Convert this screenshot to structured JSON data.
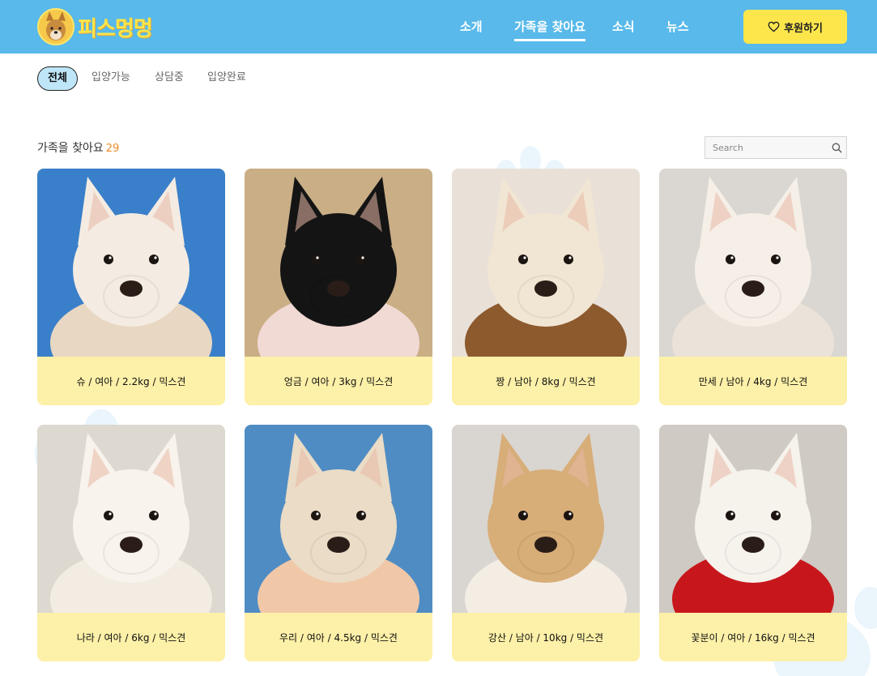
{
  "header": {
    "logo_text": "피스멍멍",
    "nav": [
      {
        "label": "소개",
        "active": false
      },
      {
        "label": "가족을 찾아요",
        "active": true
      },
      {
        "label": "소식",
        "active": false
      },
      {
        "label": "뉴스",
        "active": false
      }
    ],
    "donate_label": "후원하기",
    "donate_icon": "heart-icon"
  },
  "filters": [
    {
      "label": "전체",
      "active": true
    },
    {
      "label": "입양가능",
      "active": false
    },
    {
      "label": "상담중",
      "active": false
    },
    {
      "label": "입양완료",
      "active": false
    }
  ],
  "section": {
    "title": "가족을 찾아요",
    "count": "29"
  },
  "search": {
    "placeholder": "Search",
    "value": ""
  },
  "dogs": [
    {
      "caption": "슈 / 여아 / 2.2kg / 믹스견",
      "fur": "#f4ece2",
      "bg": "#3a7fc9",
      "coat": "#e8d7c2"
    },
    {
      "caption": "엉금 / 여아 / 3kg / 믹스견",
      "fur": "#141414",
      "bg": "#c9ae86",
      "coat": "#f1d9d4"
    },
    {
      "caption": "짱 / 남아 / 8kg / 믹스견",
      "fur": "#f1e6d3",
      "bg": "#e9e1d8",
      "coat": "#8d5a2e"
    },
    {
      "caption": "만세 / 남아 / 4kg / 믹스견",
      "fur": "#f5efe7",
      "bg": "#dad7d2",
      "coat": "#ebe3d9"
    },
    {
      "caption": "나라 / 여아 / 6kg / 믹스견",
      "fur": "#f8f3ec",
      "bg": "#ddd8d0",
      "coat": "#f3ece2"
    },
    {
      "caption": "우리 / 여아 / 4.5kg / 믹스견",
      "fur": "#eadcc6",
      "bg": "#4f8cc4",
      "coat": "#f0c8a8"
    },
    {
      "caption": "강산 / 남아 / 10kg / 믹스견",
      "fur": "#d7ad78",
      "bg": "#d9d6d1",
      "coat": "#f4ede4"
    },
    {
      "caption": "꽃분이 / 여아 / 16kg / 믹스견",
      "fur": "#f6f2ec",
      "bg": "#cfcac3",
      "coat": "#c8171c"
    }
  ],
  "colors": {
    "header_bg": "#58b9ea",
    "accent_yellow": "#fce64c",
    "caption_bg": "#fdf0a8",
    "active_filter_bg": "#bfe6f8",
    "count_orange": "#f08a2a"
  }
}
